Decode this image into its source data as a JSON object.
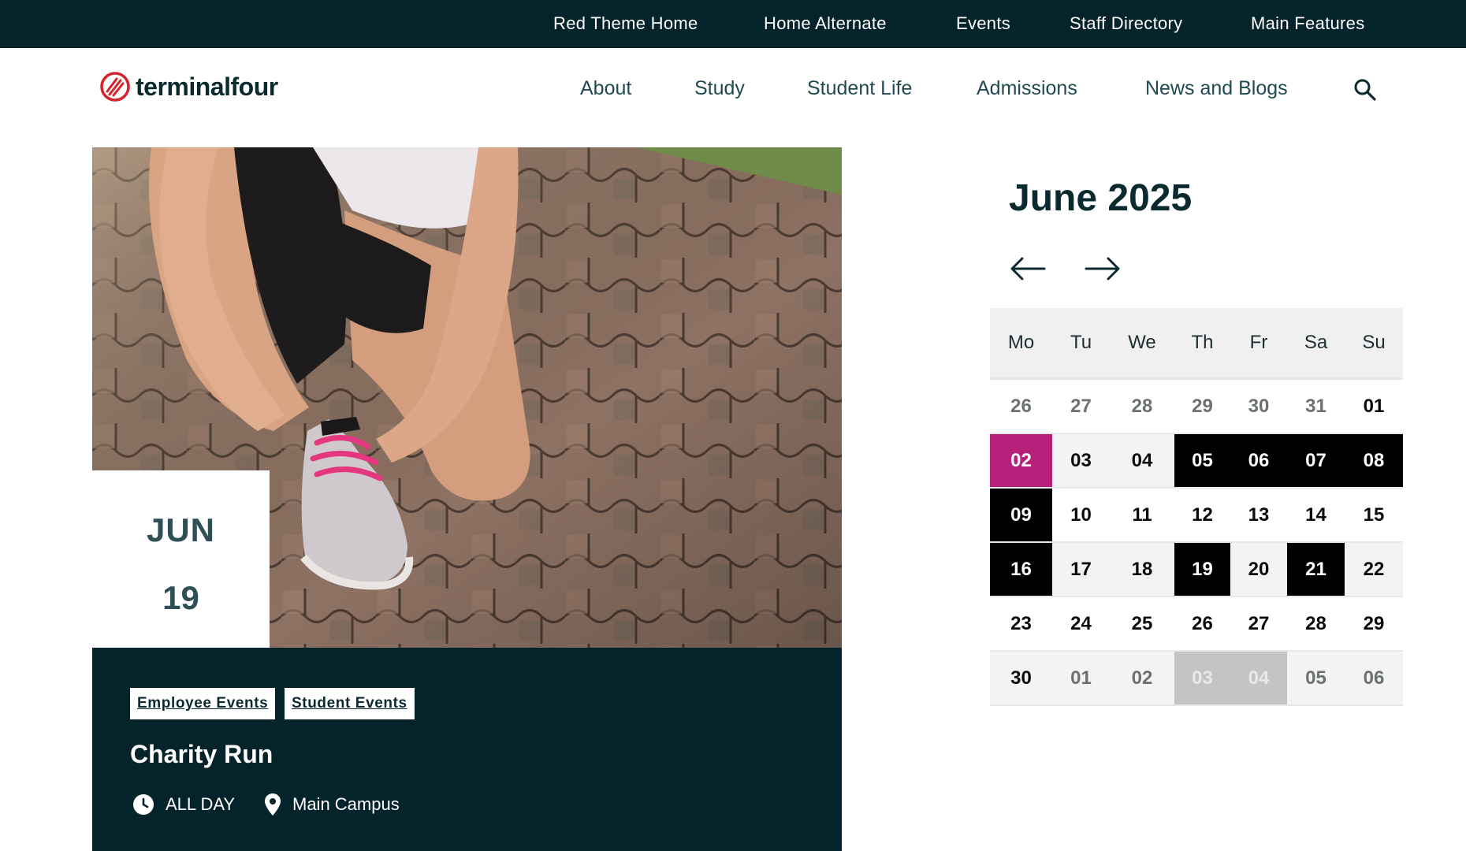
{
  "topbar": {
    "links": [
      "Red Theme Home",
      "Home Alternate",
      "Events",
      "Staff Directory",
      "Main Features"
    ]
  },
  "brand": {
    "name": "terminalfour",
    "accent_color": "#d6232b"
  },
  "nav": {
    "items": [
      "About",
      "Study",
      "Student Life",
      "Admissions",
      "News and Blogs"
    ],
    "search_icon": "search-icon"
  },
  "event": {
    "month": "JUN",
    "day": "19",
    "tags": [
      "Employee Events",
      "Student Events"
    ],
    "title": "Charity Run",
    "time": "ALL DAY",
    "location": "Main Campus",
    "time_icon": "clock-icon",
    "location_icon": "map-pin-icon"
  },
  "calendar": {
    "title": "June 2025",
    "prev_icon": "arrow-left-icon",
    "next_icon": "arrow-right-icon",
    "weekdays": [
      "Mo",
      "Tu",
      "We",
      "Th",
      "Fr",
      "Sa",
      "Su"
    ],
    "weeks": [
      [
        {
          "d": "26",
          "s": "muted"
        },
        {
          "d": "27",
          "s": "muted"
        },
        {
          "d": "28",
          "s": "muted"
        },
        {
          "d": "29",
          "s": "muted"
        },
        {
          "d": "30",
          "s": "muted"
        },
        {
          "d": "31",
          "s": "muted"
        },
        {
          "d": "01",
          "s": "normal"
        }
      ],
      [
        {
          "d": "02",
          "s": "today"
        },
        {
          "d": "03",
          "s": "normal"
        },
        {
          "d": "04",
          "s": "normal"
        },
        {
          "d": "05",
          "s": "event"
        },
        {
          "d": "06",
          "s": "event"
        },
        {
          "d": "07",
          "s": "event"
        },
        {
          "d": "08",
          "s": "event"
        }
      ],
      [
        {
          "d": "09",
          "s": "event"
        },
        {
          "d": "10",
          "s": "normal"
        },
        {
          "d": "11",
          "s": "normal"
        },
        {
          "d": "12",
          "s": "normal"
        },
        {
          "d": "13",
          "s": "normal"
        },
        {
          "d": "14",
          "s": "normal"
        },
        {
          "d": "15",
          "s": "normal"
        }
      ],
      [
        {
          "d": "16",
          "s": "event"
        },
        {
          "d": "17",
          "s": "normal"
        },
        {
          "d": "18",
          "s": "normal"
        },
        {
          "d": "19",
          "s": "event"
        },
        {
          "d": "20",
          "s": "normal"
        },
        {
          "d": "21",
          "s": "event"
        },
        {
          "d": "22",
          "s": "normal"
        }
      ],
      [
        {
          "d": "23",
          "s": "normal"
        },
        {
          "d": "24",
          "s": "normal"
        },
        {
          "d": "25",
          "s": "normal"
        },
        {
          "d": "26",
          "s": "normal"
        },
        {
          "d": "27",
          "s": "normal"
        },
        {
          "d": "28",
          "s": "normal"
        },
        {
          "d": "29",
          "s": "normal"
        }
      ],
      [
        {
          "d": "30",
          "s": "normal"
        },
        {
          "d": "01",
          "s": "muted"
        },
        {
          "d": "02",
          "s": "muted"
        },
        {
          "d": "03",
          "s": "muted-event"
        },
        {
          "d": "04",
          "s": "muted-event"
        },
        {
          "d": "05",
          "s": "muted"
        },
        {
          "d": "06",
          "s": "muted"
        }
      ]
    ],
    "colors": {
      "today": "#b5207b",
      "event": "#000000",
      "muted_event": "#c4c4c4"
    }
  }
}
